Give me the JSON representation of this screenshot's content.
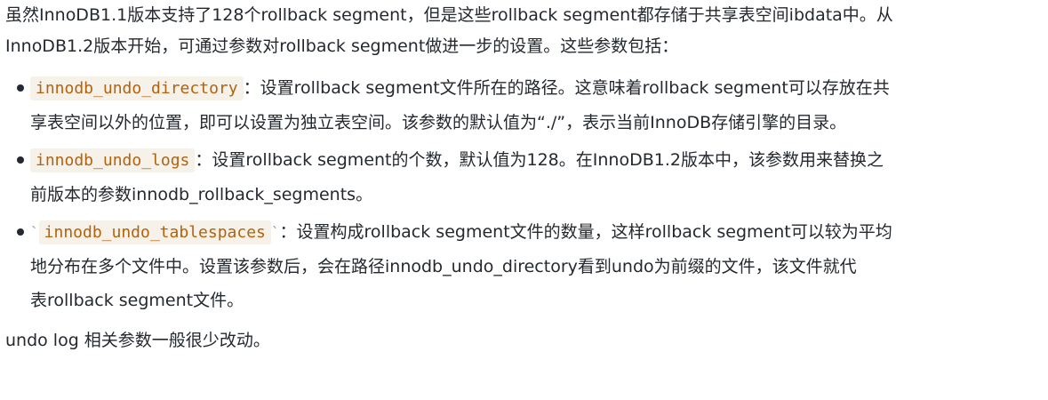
{
  "intro": {
    "line1": "虽然InnoDB1.1版本支持了128个rollback segment，但是这些rollback segment都存储于共享表空间ibdata中。从",
    "line2": "InnoDB1.2版本开始，可通过参数对rollback segment做进一步的设置。这些参数包括："
  },
  "params": [
    {
      "prefix_tick": "",
      "name": "innodb_undo_directory",
      "suffix_tick": "",
      "line1": "：设置rollback segment文件所在的路径。这意味着rollback segment可以存放在共",
      "line2": "享表空间以外的位置，即可以设置为独立表空间。该参数的默认值为“./”，表示当前InnoDB存储引擎的目录。",
      "line3": ""
    },
    {
      "prefix_tick": "",
      "name": "innodb_undo_logs",
      "suffix_tick": "",
      "line1": "：设置rollback segment的个数，默认值为128。在InnoDB1.2版本中，该参数用来替换之",
      "line2": "前版本的参数innodb_rollback_segments。",
      "line3": ""
    },
    {
      "prefix_tick": "`",
      "name": "innodb_undo_tablespaces",
      "suffix_tick": "`",
      "line1": "：设置构成rollback segment文件的数量，这样rollback segment可以较为平均",
      "line2": "地分布在多个文件中。设置该参数后，会在路径innodb_undo_directory看到undo为前缀的文件，该文件就代",
      "line3": "表rollback segment文件。"
    }
  ],
  "outro": "undo log 相关参数一般很少改动。"
}
